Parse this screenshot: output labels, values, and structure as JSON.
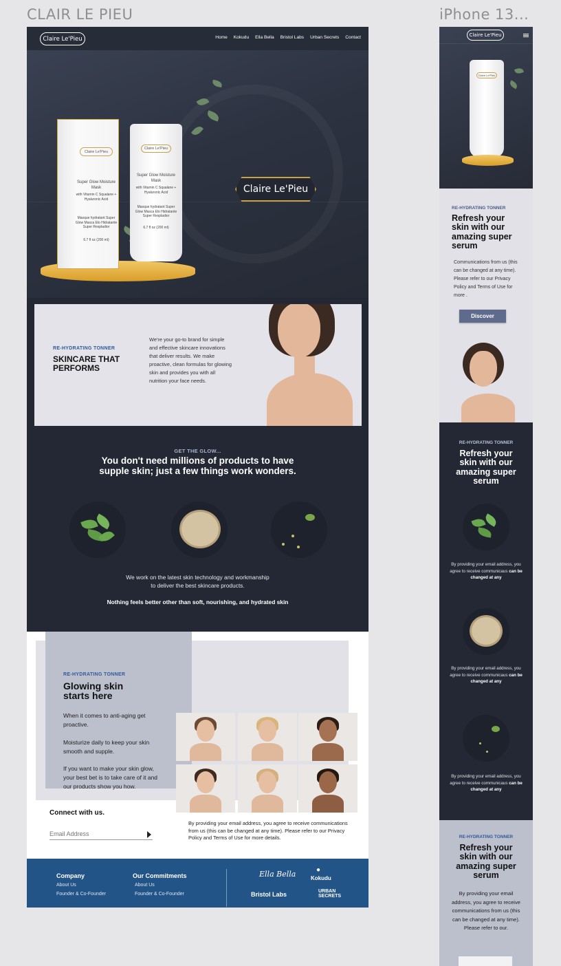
{
  "frames": {
    "desktop_label": "CLAIR LE PIEU",
    "mobile_label": "iPhone 13..."
  },
  "brand": {
    "logo": "Claire Le'Pieu",
    "accent": "#c9a244",
    "navy": "#232834",
    "footer_blue": "#235488"
  },
  "nav": {
    "items": [
      "Home",
      "Kokudu",
      "Ella Bella",
      "Bristol Labs",
      "Urban Secrets",
      "Contact"
    ]
  },
  "hero": {
    "box_badge": "Claire Le'Pieu",
    "box_title": "Super Glow Moisture Mask",
    "box_sub": "with Vitamin C Squalane + Hyaluronic Acid",
    "box_features": "Masque hydratant Super Glow Masca Elo Hidratante Super Respladior",
    "box_size": "6.7 fl oz (200 ml)",
    "tube_badge": "Claire Le'Pieu",
    "tube_title": "Super Glow Moisture Mask",
    "tube_sub": "with Vitamin C Squalane + Hyaluronic Acid",
    "tube_features": "Masque hydratant Super Glow Masca Elo Hidratante Super Respladior",
    "tube_size": "6.7 fl oz (200 ml)"
  },
  "about": {
    "eyebrow": "RE-HYDRATING TONNER",
    "title_line1": "SKINCARE THAT",
    "title_line2": "PERFORMS",
    "body": "We're your go-to brand for simple and effective skincare innovations that deliver results. We make proactive, clean formulas for glowing skin and provides you with all nutrition your face needs."
  },
  "glow": {
    "eyebrow": "GET THE GLOW...",
    "heading_line1": "You don't need millions of products to have",
    "heading_line2": "supple skin; just a few things work wonders.",
    "body_line1": "We work on the latest skin technology and workmanship",
    "body_line2": "to deliver the best skincare products.",
    "tagline": "Nothing feels better other than soft, nourishing, and hydrated skin"
  },
  "glowing": {
    "eyebrow": "RE-HYDRATING TONNER",
    "title_line1": "Glowing skin",
    "title_line2": "starts here",
    "p1": "When it comes to anti-aging get proactive.",
    "p2": "Moisturize daily to keep your skin smooth and supple.",
    "p3": "If you want to make your skin glow, your best bet is to take care of it and our products show you how."
  },
  "connect": {
    "title": "Connect with us.",
    "email_placeholder": "Email Address",
    "disclaimer": "By providing your email address, you agree to receive communications from us (this can be changed at any time). Please refer to our Privacy Policy and Terms of Use for more details."
  },
  "footer": {
    "company_title": "Company",
    "company_links": [
      "About Us",
      "Founder & Co-Founder"
    ],
    "commit_title": "Our Commitments",
    "commit_links": [
      "About Us",
      "Founder & Co-Founder"
    ],
    "brands": [
      "Ella Bella",
      "Kokudu",
      "Bristol Labs",
      "URBAN SECRETS"
    ]
  },
  "mobile": {
    "logo": "Claire Le'Pieu",
    "intro": {
      "eyebrow": "RE-HYDRATING TONNER",
      "title_l1": "Refresh your",
      "title_l2": "skin with our",
      "title_l3": "amazing super",
      "title_l4": "serum",
      "body": "Communications from us (this can be changed at any time). Please refer to our Privacy Policy and Terms of Use for more .",
      "cta": "Discover"
    },
    "dark": {
      "eyebrow": "RE-HYDRATING TONNER",
      "title_l1": "Refresh your",
      "title_l2": "skin with our",
      "title_l3": "amazing super",
      "title_l4": "serum",
      "card_text": "By providing your email address, you agree to receive communicaus",
      "card_bold": "can be changed at any"
    },
    "bottom": {
      "eyebrow": "RE-HYDRATING TONNER",
      "title_l1": "Refresh your",
      "title_l2": "skin with our",
      "title_l3": "amazing super",
      "title_l4": "serum",
      "body": "By providing your email address, you agree to receive communications from us (this can be changed at any time). Please refer to our."
    }
  }
}
